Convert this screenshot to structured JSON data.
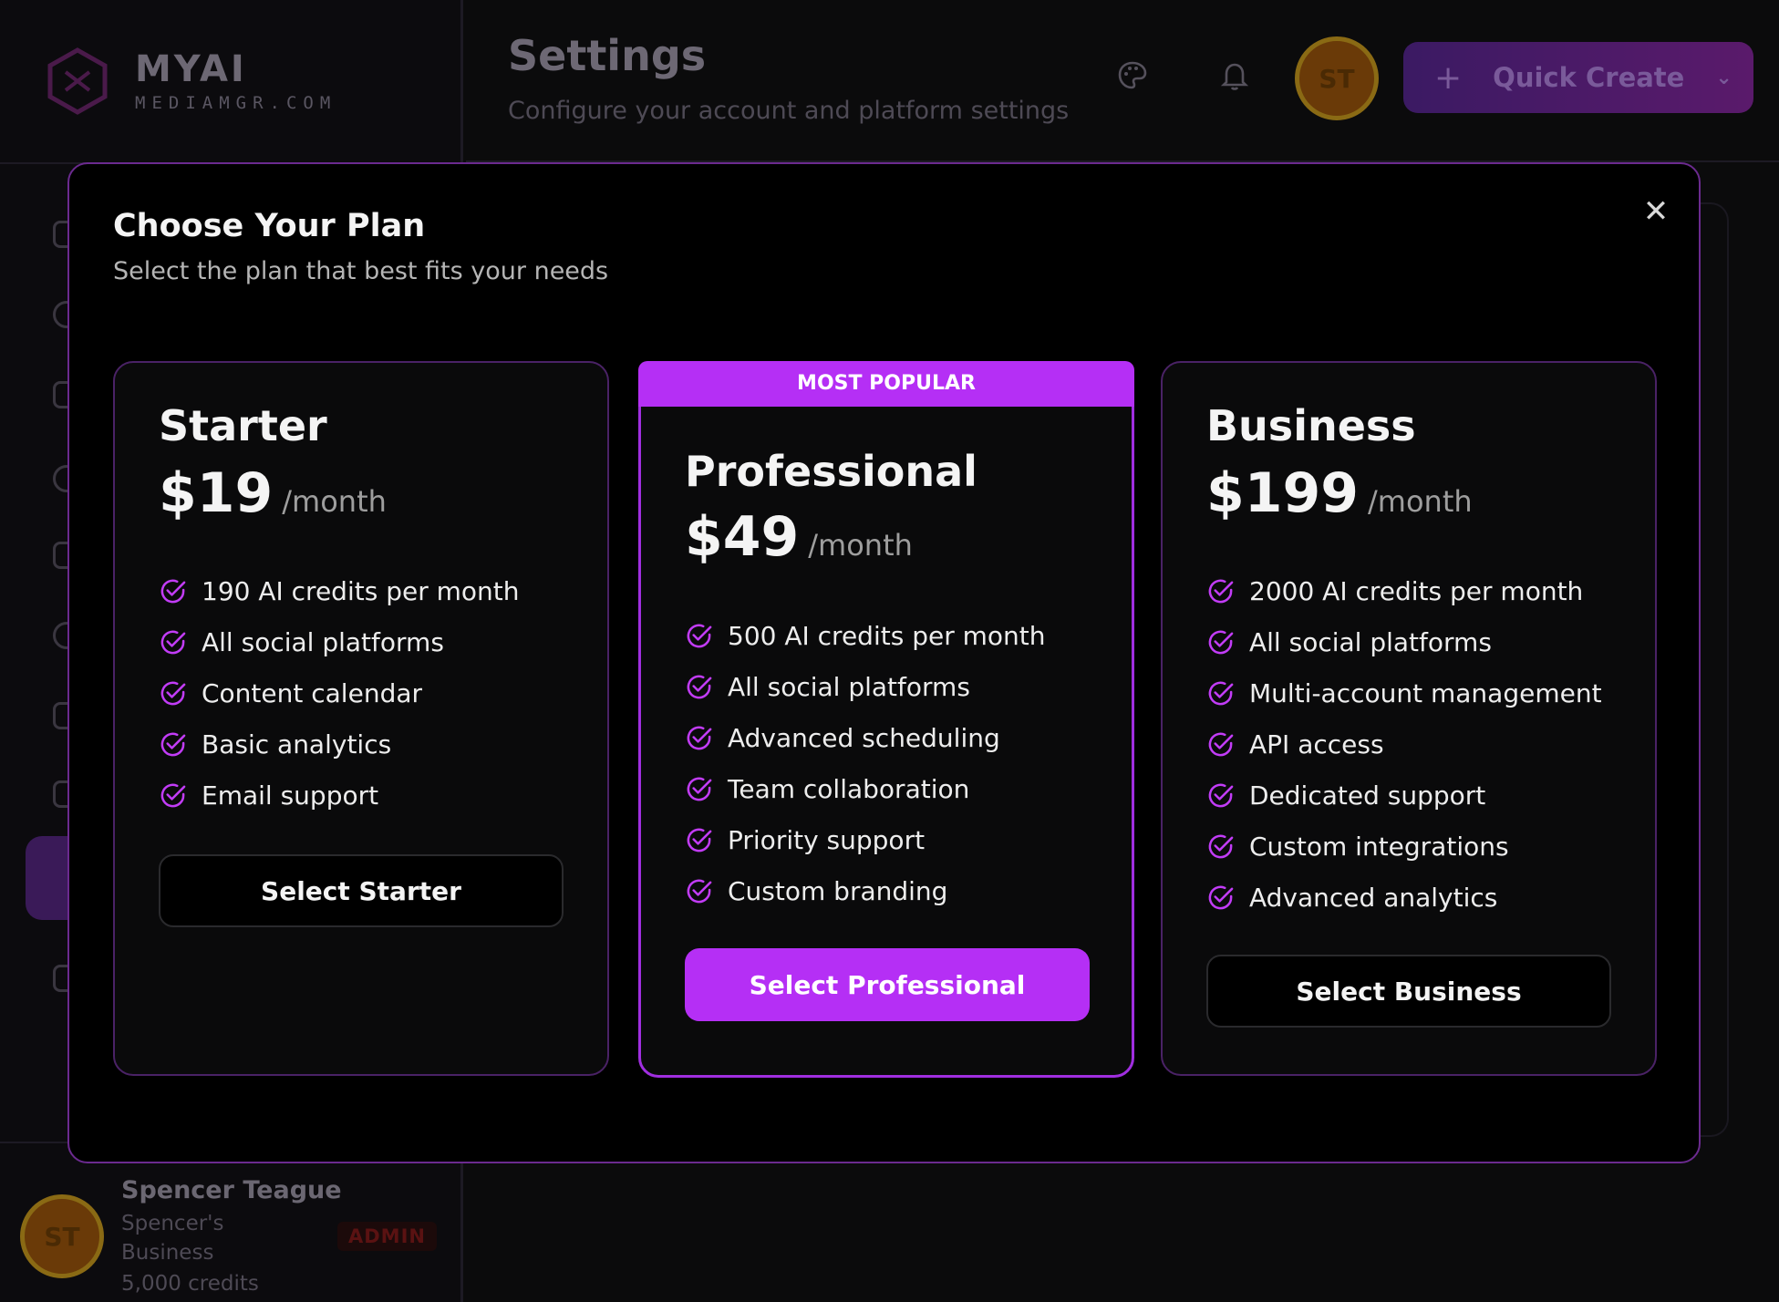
{
  "brand": {
    "name": "MYAI",
    "domain": "MEDIAMGR.COM"
  },
  "header": {
    "title": "Settings",
    "subtitle": "Configure your account and platform settings",
    "avatar_initials": "ST",
    "quick_create_label": "Quick Create"
  },
  "user": {
    "initials": "ST",
    "name": "Spencer Teague",
    "business": "Spencer's Business",
    "credits": "5,000 credits",
    "role_badge": "ADMIN"
  },
  "modal": {
    "title": "Choose Your Plan",
    "subtitle": "Select the plan that best fits your needs",
    "plans": [
      {
        "name": "Starter",
        "price": "$19",
        "period": "/month",
        "features": [
          "190 AI credits per month",
          "All social platforms",
          "Content calendar",
          "Basic analytics",
          "Email support"
        ],
        "button": "Select Starter"
      },
      {
        "badge": "MOST POPULAR",
        "name": "Professional",
        "price": "$49",
        "period": "/month",
        "features": [
          "500 AI credits per month",
          "All social platforms",
          "Advanced scheduling",
          "Team collaboration",
          "Priority support",
          "Custom branding"
        ],
        "button": "Select Professional"
      },
      {
        "name": "Business",
        "price": "$199",
        "period": "/month",
        "features": [
          "2000 AI credits per month",
          "All social platforms",
          "Multi-account management",
          "API access",
          "Dedicated support",
          "Custom integrations",
          "Advanced analytics"
        ],
        "button": "Select Business"
      }
    ]
  },
  "colors": {
    "accent": "#b52ff5",
    "modal_border": "#6b2a8f",
    "background": "#000000"
  },
  "icons": {
    "close": "close-icon",
    "check": "check-circle-icon",
    "palette": "palette-icon",
    "bell": "bell-icon",
    "plus": "plus-icon",
    "chevron": "chevron-down-icon"
  }
}
